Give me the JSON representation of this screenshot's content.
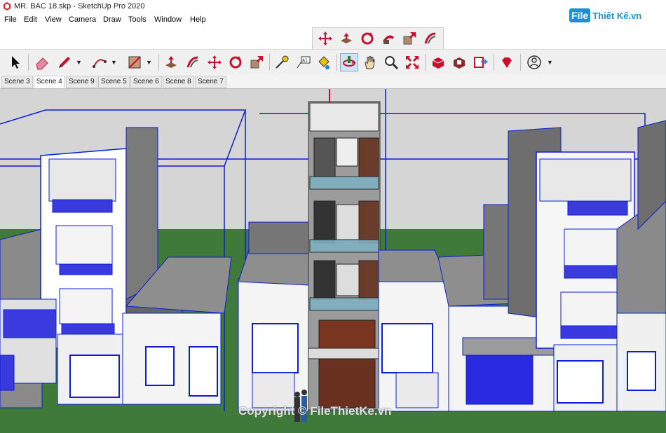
{
  "window": {
    "title": "MR. BAC 18.skp - SketchUp Pro 2020",
    "app_icon": "sketchup-icon"
  },
  "menu": [
    "File",
    "Edit",
    "View",
    "Camera",
    "Draw",
    "Tools",
    "Window",
    "Help"
  ],
  "logo": {
    "prefix": "File",
    "text": "Thiết Kế.vn"
  },
  "watermark": "Copyright © FileThietKe.vn",
  "scenes": {
    "tabs": [
      "Scene 3",
      "Scene 4",
      "Scene 9",
      "Scene 5",
      "Scene 6",
      "Scene 8",
      "Scene 7"
    ],
    "active": "Scene 4"
  },
  "colors": {
    "outline": "#0a1fd8",
    "ground": "#3f7a3a",
    "sky": "#d5d5d5",
    "accent_red": "#c8102e"
  }
}
